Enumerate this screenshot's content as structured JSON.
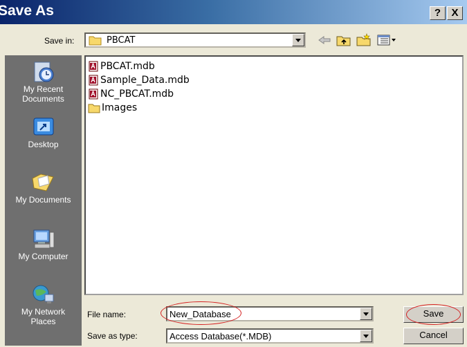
{
  "window": {
    "title": "Save As",
    "help_glyph": "?",
    "close_glyph": "X"
  },
  "save_in": {
    "label": "Save in:",
    "value": "PBCAT",
    "folder_icon": "folder-icon"
  },
  "toolbar": {
    "icons": [
      "back-arrow-icon",
      "up-folder-icon",
      "new-folder-icon",
      "views-menu-icon"
    ]
  },
  "places": [
    {
      "label_lines": [
        "My Recent",
        "Documents"
      ],
      "icon": "recent-documents-icon"
    },
    {
      "label_lines": [
        "Desktop"
      ],
      "icon": "desktop-icon"
    },
    {
      "label_lines": [
        "My Documents"
      ],
      "icon": "my-documents-icon"
    },
    {
      "label_lines": [
        "My Computer"
      ],
      "icon": "my-computer-icon"
    },
    {
      "label_lines": [
        "My Network",
        "Places"
      ],
      "icon": "network-places-icon"
    }
  ],
  "files": [
    {
      "name": "PBCAT.mdb",
      "icon": "access-db-icon"
    },
    {
      "name": "Sample_Data.mdb",
      "icon": "access-db-icon"
    },
    {
      "name": "NC_PBCAT.mdb",
      "icon": "access-db-icon"
    },
    {
      "name": "Images",
      "icon": "folder-icon"
    }
  ],
  "file_name": {
    "label": "File name:",
    "value": "New_Database"
  },
  "save_type": {
    "label": "Save as type:",
    "value": "Access Database(*.MDB)"
  },
  "buttons": {
    "save": "Save",
    "cancel": "Cancel"
  },
  "colors": {
    "highlight_oval": "#d42020",
    "places_bar": "#6f6f6f",
    "title_bar": "#0a246a"
  }
}
